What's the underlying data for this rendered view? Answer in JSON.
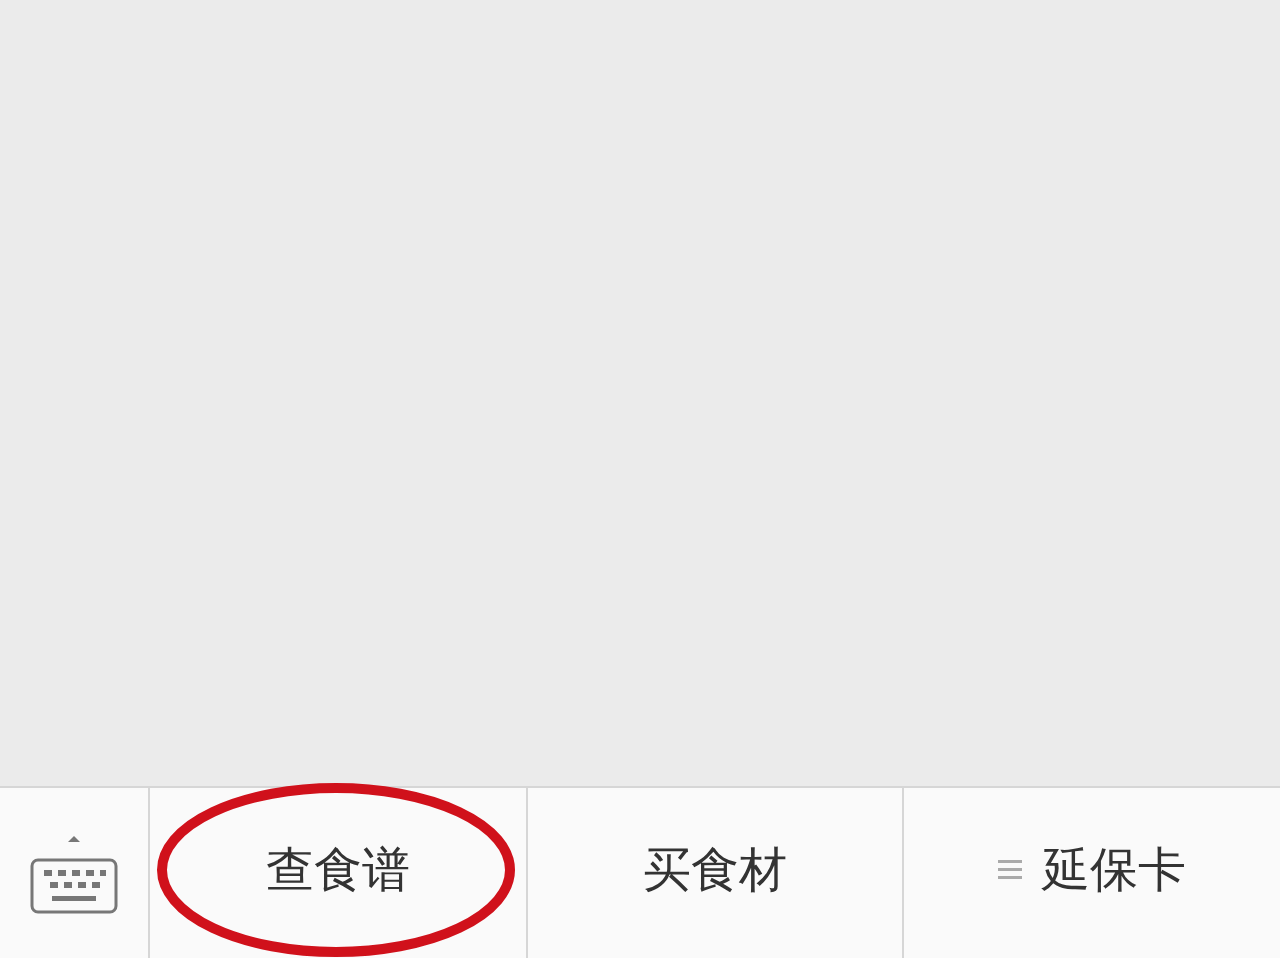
{
  "menu_bar": {
    "items": [
      {
        "label": "查食谱",
        "circled": true,
        "has_submenu": false
      },
      {
        "label": "买食材",
        "circled": false,
        "has_submenu": false
      },
      {
        "label": "延保卡",
        "circled": false,
        "has_submenu": true
      }
    ]
  }
}
